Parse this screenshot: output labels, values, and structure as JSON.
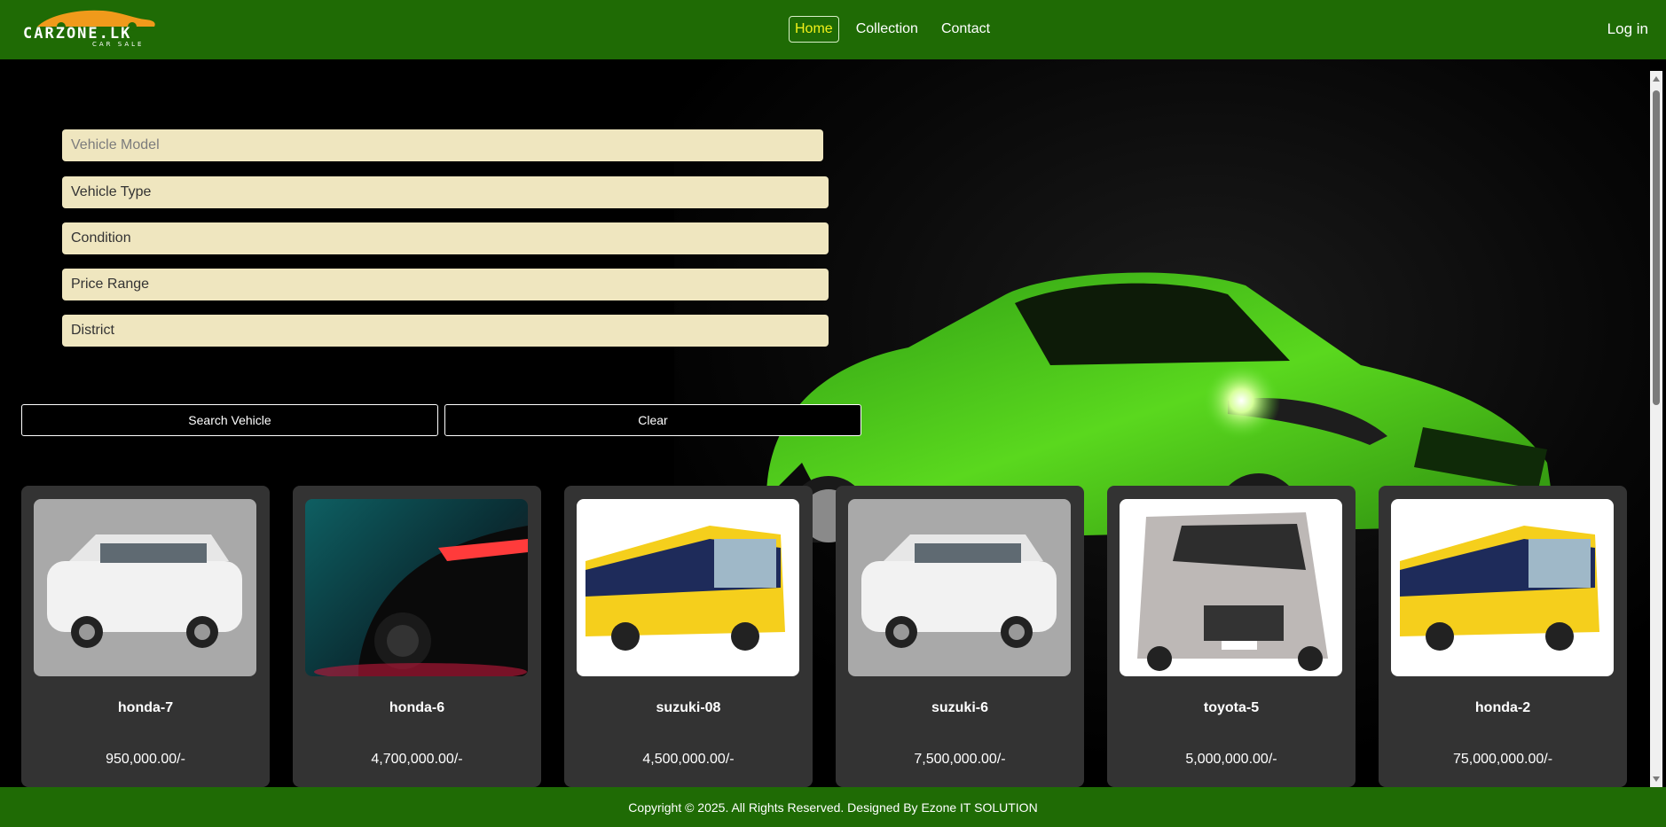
{
  "brand": {
    "logo_text": "CARZONE.LK",
    "logo_sub": "CAR SALE"
  },
  "nav": {
    "items": [
      {
        "label": "Home",
        "active": true
      },
      {
        "label": "Collection",
        "active": false
      },
      {
        "label": "Contact",
        "active": false
      }
    ],
    "login": "Log in"
  },
  "filters": {
    "vehicle_model_placeholder": "Vehicle Model",
    "vehicle_type": "Vehicle Type",
    "condition": "Condition",
    "price_range": "Price Range",
    "district": "District"
  },
  "actions": {
    "search": "Search Vehicle",
    "clear": "Clear"
  },
  "vehicles": [
    {
      "name": "honda-7",
      "price": "950,000.00/-",
      "image": "white-van-icon"
    },
    {
      "name": "honda-6",
      "price": "4,700,000.00/-",
      "image": "sports-car-taillight-icon"
    },
    {
      "name": "suzuki-08",
      "price": "4,500,000.00/-",
      "image": "yellow-bus-icon"
    },
    {
      "name": "suzuki-6",
      "price": "7,500,000.00/-",
      "image": "white-van-icon"
    },
    {
      "name": "toyota-5",
      "price": "5,000,000.00/-",
      "image": "silver-van-icon"
    },
    {
      "name": "honda-2",
      "price": "75,000,000.00/-",
      "image": "yellow-bus-icon"
    }
  ],
  "footer": {
    "copyright": "Copyright © 2025. All Rights Reserved. Designed By Ezone IT SOLUTION"
  },
  "colors": {
    "header": "#1f6b05",
    "active_nav": "#f2f01a",
    "field_bg": "#efe6bf",
    "card_bg": "#333333"
  }
}
